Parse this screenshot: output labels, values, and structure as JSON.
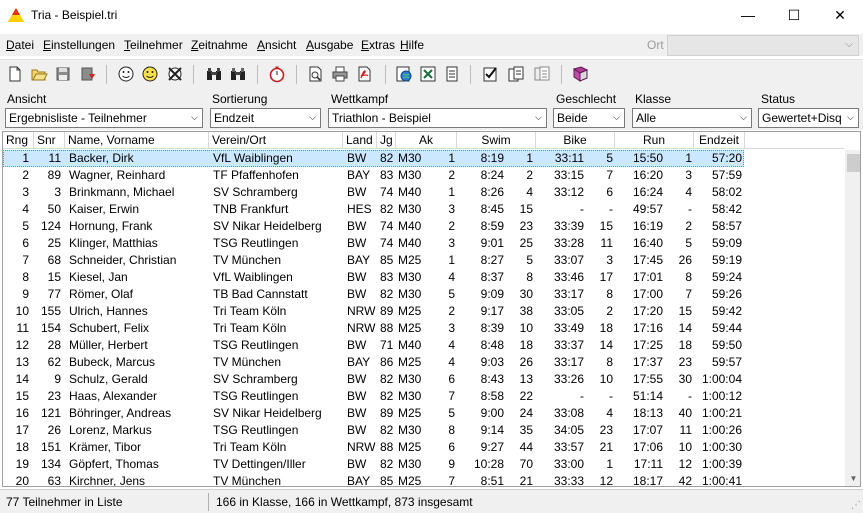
{
  "window": {
    "title": "Tria  -  Beispiel.tri",
    "controls": {
      "minimize": "—",
      "maximize": "☐",
      "close": "✕"
    }
  },
  "menu": {
    "items": [
      {
        "label": "Datei",
        "ul": "D",
        "rest": "atei"
      },
      {
        "label": "Einstellungen",
        "ul": "E",
        "rest": "instellungen"
      },
      {
        "label": "Teilnehmer",
        "ul": "T",
        "rest": "eilnehmer"
      },
      {
        "label": "Zeitnahme",
        "ul": "Z",
        "rest": "eitnahme"
      },
      {
        "label": "Ansicht",
        "ul": "A",
        "rest": "nsicht"
      },
      {
        "label": "Ausgabe",
        "ul": "A",
        "rest": "usgabe"
      },
      {
        "label": "Extras",
        "ul": "E",
        "rest": "xtras"
      },
      {
        "label": "Hilfe",
        "ul": "H",
        "rest": "ilfe"
      }
    ],
    "ort_label": "Ort"
  },
  "toolbar": {
    "icons": [
      "new-file-icon",
      "open-folder-icon",
      "save-icon",
      "import-icon",
      "smiley-icon",
      "smiley-yellow-icon",
      "delete-person-icon",
      "binoculars-icon",
      "binoculars-alt-icon",
      "stopwatch-icon",
      "print-preview-icon",
      "print-icon",
      "pdf-icon",
      "globe-icon",
      "excel-icon",
      "notepad-icon",
      "checklist-icon",
      "copy-document-icon",
      "document-stack-icon",
      "book-icon"
    ]
  },
  "filters": {
    "ansicht": {
      "label": "Ansicht",
      "value": "Ergebnisliste - Teilnehmer"
    },
    "sortierung": {
      "label": "Sortierung",
      "value": "Endzeit"
    },
    "wettkampf": {
      "label": "Wettkampf",
      "value": "Triathlon - Beispiel"
    },
    "geschlecht": {
      "label": "Geschlecht",
      "value": "Beide"
    },
    "klasse": {
      "label": "Klasse",
      "value": "Alle"
    },
    "status": {
      "label": "Status",
      "value": "Gewertet+Disq"
    }
  },
  "table": {
    "headers": {
      "rng": "Rng",
      "snr": "Snr",
      "name": "Name, Vorname",
      "verein": "Verein/Ort",
      "land": "Land",
      "jg": "Jg",
      "ak": "Ak",
      "swim": "Swim",
      "bike": "Bike",
      "run": "Run",
      "endzeit": "Endzeit"
    },
    "rows": [
      [
        "1",
        "11",
        "Backer, Dirk",
        "VfL Waiblingen",
        "BW",
        "82",
        "M30",
        "1",
        "8:19",
        "1",
        "33:11",
        "5",
        "15:50",
        "1",
        "57:20"
      ],
      [
        "2",
        "89",
        "Wagner, Reinhard",
        "TF Pfaffenhofen",
        "BAY",
        "83",
        "M30",
        "2",
        "8:24",
        "2",
        "33:15",
        "7",
        "16:20",
        "3",
        "57:59"
      ],
      [
        "3",
        "3",
        "Brinkmann, Michael",
        "SV Schramberg",
        "BW",
        "74",
        "M40",
        "1",
        "8:26",
        "4",
        "33:12",
        "6",
        "16:24",
        "4",
        "58:02"
      ],
      [
        "4",
        "50",
        "Kaiser, Erwin",
        "TNB Frankfurt",
        "HES",
        "82",
        "M30",
        "3",
        "8:45",
        "15",
        "-",
        "-",
        "49:57",
        "-",
        "58:42"
      ],
      [
        "5",
        "124",
        "Hornung, Frank",
        "SV Nikar Heidelberg",
        "BW",
        "74",
        "M40",
        "2",
        "8:59",
        "23",
        "33:39",
        "15",
        "16:19",
        "2",
        "58:57"
      ],
      [
        "6",
        "25",
        "Klinger, Matthias",
        "TSG Reutlingen",
        "BW",
        "74",
        "M40",
        "3",
        "9:01",
        "25",
        "33:28",
        "11",
        "16:40",
        "5",
        "59:09"
      ],
      [
        "7",
        "68",
        "Schneider, Christian",
        "TV München",
        "BAY",
        "85",
        "M25",
        "1",
        "8:27",
        "5",
        "33:07",
        "3",
        "17:45",
        "26",
        "59:19"
      ],
      [
        "8",
        "15",
        "Kiesel, Jan",
        "VfL Waiblingen",
        "BW",
        "83",
        "M30",
        "4",
        "8:37",
        "8",
        "33:46",
        "17",
        "17:01",
        "8",
        "59:24"
      ],
      [
        "9",
        "77",
        "Römer, Olaf",
        "TB Bad Cannstatt",
        "BW",
        "82",
        "M30",
        "5",
        "9:09",
        "30",
        "33:17",
        "8",
        "17:00",
        "7",
        "59:26"
      ],
      [
        "10",
        "155",
        "Ulrich, Hannes",
        "Tri Team Köln",
        "NRW",
        "89",
        "M25",
        "2",
        "9:17",
        "38",
        "33:05",
        "2",
        "17:20",
        "15",
        "59:42"
      ],
      [
        "11",
        "154",
        "Schubert, Felix",
        "Tri Team Köln",
        "NRW",
        "88",
        "M25",
        "3",
        "8:39",
        "10",
        "33:49",
        "18",
        "17:16",
        "14",
        "59:44"
      ],
      [
        "12",
        "28",
        "Müller, Herbert",
        "TSG Reutlingen",
        "BW",
        "71",
        "M40",
        "4",
        "8:48",
        "18",
        "33:37",
        "14",
        "17:25",
        "18",
        "59:50"
      ],
      [
        "13",
        "62",
        "Bubeck, Marcus",
        "TV München",
        "BAY",
        "86",
        "M25",
        "4",
        "9:03",
        "26",
        "33:17",
        "8",
        "17:37",
        "23",
        "59:57"
      ],
      [
        "14",
        "9",
        "Schulz, Gerald",
        "SV Schramberg",
        "BW",
        "82",
        "M30",
        "6",
        "8:43",
        "13",
        "33:26",
        "10",
        "17:55",
        "30",
        "1:00:04"
      ],
      [
        "15",
        "23",
        "Haas, Alexander",
        "TSG Reutlingen",
        "BW",
        "82",
        "M30",
        "7",
        "8:58",
        "22",
        "-",
        "-",
        "51:14",
        "-",
        "1:00:12"
      ],
      [
        "16",
        "121",
        "Böhringer, Andreas",
        "SV Nikar Heidelberg",
        "BW",
        "89",
        "M25",
        "5",
        "9:00",
        "24",
        "33:08",
        "4",
        "18:13",
        "40",
        "1:00:21"
      ],
      [
        "17",
        "26",
        "Lorenz, Markus",
        "TSG Reutlingen",
        "BW",
        "82",
        "M30",
        "8",
        "9:14",
        "35",
        "34:05",
        "23",
        "17:07",
        "11",
        "1:00:26"
      ],
      [
        "18",
        "151",
        "Krämer, Tibor",
        "Tri Team Köln",
        "NRW",
        "88",
        "M25",
        "6",
        "9:27",
        "44",
        "33:57",
        "21",
        "17:06",
        "10",
        "1:00:30"
      ],
      [
        "19",
        "134",
        "Göpfert, Thomas",
        "TV Dettingen/Iller",
        "BW",
        "82",
        "M30",
        "9",
        "10:28",
        "70",
        "33:00",
        "1",
        "17:11",
        "12",
        "1:00:39"
      ],
      [
        "20",
        "63",
        "Kirchner, Jens",
        "TV München",
        "BAY",
        "85",
        "M25",
        "7",
        "8:51",
        "21",
        "33:33",
        "12",
        "18:17",
        "42",
        "1:00:41"
      ]
    ]
  },
  "status": {
    "left": "77  Teilnehmer in Liste",
    "right": "166  in Klasse,  166  in Wettkampf,  873  insgesamt"
  }
}
